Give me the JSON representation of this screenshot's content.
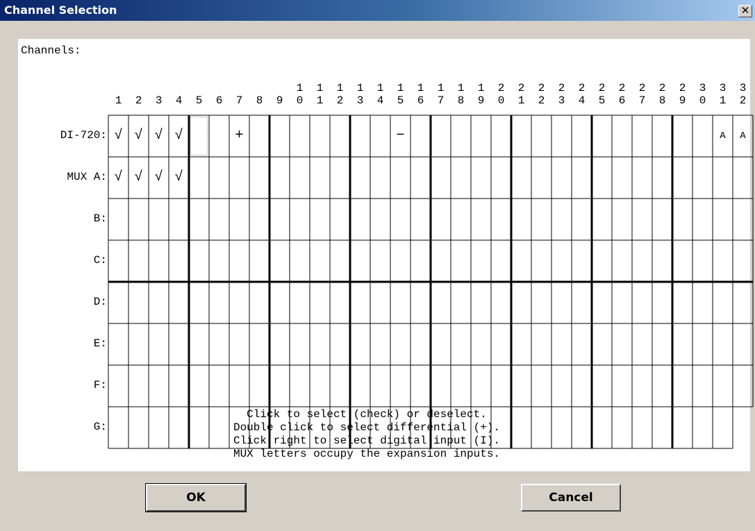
{
  "window": {
    "title": "Channel Selection",
    "close_glyph": "✕"
  },
  "channels_label": "Channels:",
  "channel_numbers": [
    "1",
    "2",
    "3",
    "4",
    "5",
    "6",
    "7",
    "8",
    "9",
    "10",
    "11",
    "12",
    "13",
    "14",
    "15",
    "16",
    "17",
    "18",
    "19",
    "20",
    "21",
    "22",
    "23",
    "24",
    "25",
    "26",
    "27",
    "28",
    "29",
    "30",
    "31",
    "32"
  ],
  "rows": [
    {
      "label": "DI-720:",
      "cells": {
        "1": "√",
        "2": "√",
        "3": "√",
        "4": "√",
        "7": "+",
        "15": "−",
        "31": "A",
        "32": "A"
      }
    },
    {
      "label": "MUX A:",
      "cells": {
        "1": "√",
        "2": "√",
        "3": "√",
        "4": "√"
      }
    },
    {
      "label": "B:",
      "cells": {}
    },
    {
      "label": "C:",
      "cells": {}
    },
    {
      "label": "D:",
      "cells": {}
    },
    {
      "label": "E:",
      "cells": {}
    },
    {
      "label": "F:",
      "cells": {}
    },
    {
      "label": "G:",
      "cells": {}
    }
  ],
  "instructions": [
    "Click to select (check) or deselect.",
    "Double click to select differential (+).",
    "Click right to select digital input (I).",
    "MUX letters occupy the expansion inputs."
  ],
  "buttons": {
    "ok": "OK",
    "cancel": "Cancel"
  }
}
